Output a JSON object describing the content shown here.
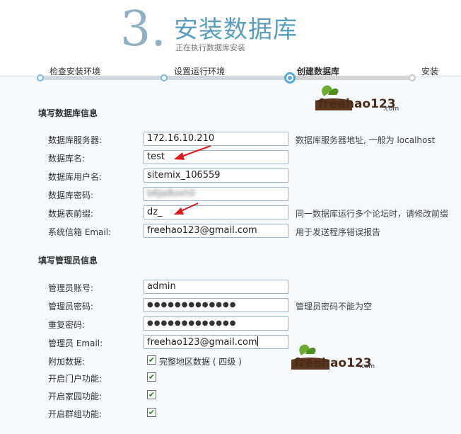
{
  "header": {
    "step_number": "3.",
    "title": "安装数据库",
    "subtitle": "正在执行数据库安装"
  },
  "steps": [
    {
      "label": "检查安装环境",
      "state": "done"
    },
    {
      "label": "设置运行环境",
      "state": "done"
    },
    {
      "label": "创建数据库",
      "state": "active"
    },
    {
      "label": "安装",
      "state": "pending"
    }
  ],
  "db_section": {
    "heading": "填写数据库信息",
    "fields": {
      "server": {
        "label": "数据库服务器:",
        "value": "172.16.10.210",
        "hint": "数据库服务器地址, 一般为 localhost"
      },
      "name": {
        "label": "数据库名:",
        "value": "test"
      },
      "user": {
        "label": "数据库用户名:",
        "value": "sitemix_106559"
      },
      "password": {
        "label": "数据库密码:",
        "value": "b6Ja8oxh0"
      },
      "prefix": {
        "label": "数据表前缀:",
        "value": "dz_",
        "hint": "同一数据库运行多个论坛时，请修改前缀"
      },
      "email": {
        "label": "系统信箱 Email:",
        "value": "freehao123@gmail.com",
        "hint": "用于发送程序错误报告"
      }
    }
  },
  "admin_section": {
    "heading": "填写管理员信息",
    "fields": {
      "account": {
        "label": "管理员账号:",
        "value": "admin"
      },
      "password": {
        "label": "管理员密码:",
        "value": "●●●●●●●●●●●●●",
        "hint": "管理员密码不能为空"
      },
      "repeat": {
        "label": "重复密码:",
        "value": "●●●●●●●●●●●●●"
      },
      "email": {
        "label": "管理员 Email:",
        "value": "freehao123@gmail.com"
      }
    },
    "options": {
      "extra": {
        "label": "附加数据:",
        "checkbox_label": "完整地区数据 ( 四级 )",
        "checked": true
      },
      "portal": {
        "label": "开启门户功能:",
        "checked": true
      },
      "home": {
        "label": "开启家园功能:",
        "checked": true
      },
      "group": {
        "label": "开启群组功能:",
        "checked": true
      }
    }
  },
  "watermark": {
    "text": "freehao123",
    "suffix": ".com"
  },
  "colors": {
    "accent": "#5b9dbc",
    "step_number": "#8fb1c3",
    "progress_dot": "#5aa8d8",
    "arrow": "#e0191d",
    "check": "#2c8a2c"
  },
  "check_glyph": "✔"
}
